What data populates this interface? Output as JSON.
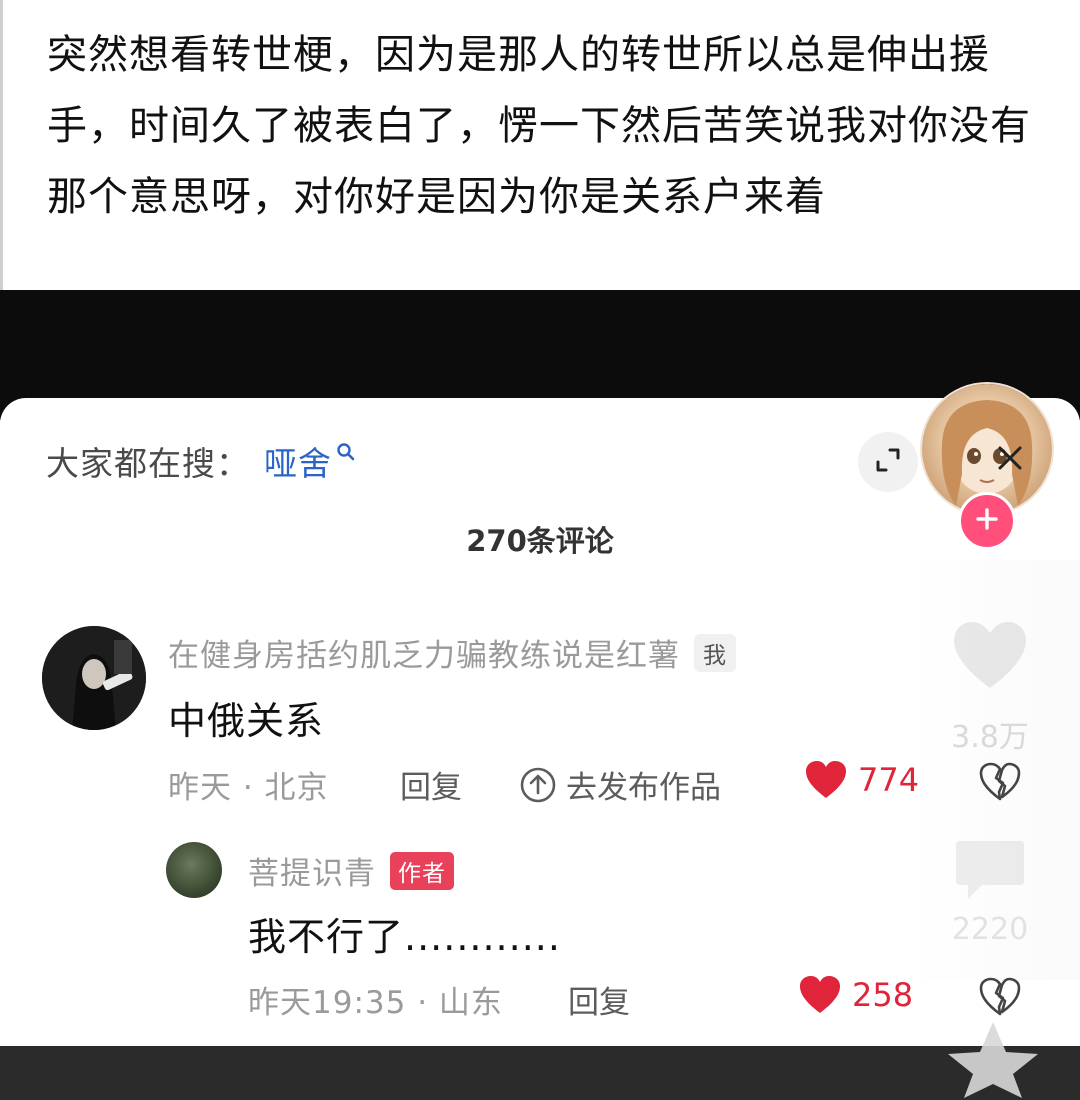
{
  "post": {
    "text": "突然想看转世梗，因为是那人的转世所以总是伸出援手，时间久了被表白了，愣一下然后苦笑说我对你没有那个意思呀，对你好是因为你是关系户来着"
  },
  "comment_sheet": {
    "search_prefix": "大家都在搜：",
    "search_term": "哑舍",
    "comment_count": "270条评论",
    "side_like_count": "3.8万",
    "side_comment_count": "2220"
  },
  "comments": [
    {
      "username": "在健身房括约肌乏力骗教练说是红薯",
      "badge": "我",
      "text": "中俄关系",
      "time_location": "昨天 · 北京",
      "reply_label": "回复",
      "publish_label": "去发布作品",
      "likes": "774"
    }
  ],
  "replies": [
    {
      "username": "菩提识青",
      "badge": "作者",
      "text": "我不行了............",
      "time_location": "昨天19:35 · 山东",
      "reply_label": "回复",
      "likes": "258"
    }
  ],
  "colors": {
    "like_red": "#e0243a",
    "search_blue": "#2b64c8",
    "author_badge": "#e8415a",
    "follow_pink": "#ff4f7a"
  },
  "icons": [
    "search-icon",
    "expand-icon",
    "close-icon",
    "plus-icon",
    "heart-icon",
    "broken-heart-icon",
    "upload-icon",
    "star-icon"
  ]
}
